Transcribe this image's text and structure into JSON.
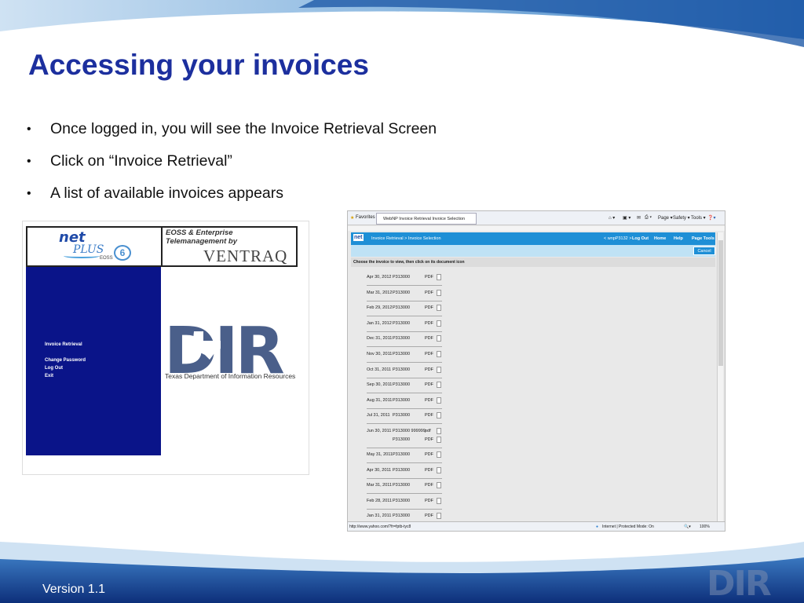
{
  "slide": {
    "title": "Accessing your invoices",
    "bullets": [
      "Once logged in, you will see the Invoice Retrieval Screen",
      "Click on “Invoice Retrieval”",
      "A list of available invoices appears"
    ],
    "bullet_glyph": "•",
    "footer": "Version 1.1",
    "footer_logo": "DIR"
  },
  "screenshot1": {
    "logo_net": "net",
    "logo_plus": "PLUS",
    "logo_eoss": "EOSS",
    "logo_6": "6",
    "header_line1": "EOSS & Enterprise",
    "header_line2": "Telemanagement by",
    "vendor": "VENTRAQ",
    "nav": [
      "Invoice Retrieval",
      "Change Password",
      "Log Out",
      "Exit"
    ],
    "dir_letters": "DIR",
    "dir_caption": "Texas Department of Information Resources"
  },
  "screenshot2": {
    "favorites": "Favorites",
    "tab_title": "WebNP Invoice Retrieval Invoice Selection",
    "toolbar": [
      "Page ▾",
      "Safety ▾",
      "Tools ▾"
    ],
    "breadcrumb": "Invoice Retrieval > Invoice Selection",
    "user": "< wnpP3132 >",
    "nav": [
      "Log Out",
      "Home",
      "Help",
      "Page Tools"
    ],
    "cancel": "Cancel",
    "instruction": "Choose the invoice to view, then click on its document icon",
    "invoices": [
      {
        "date": "Apr 30, 2012",
        "account": "P313000",
        "type": "PDF"
      },
      {
        "date": "Mar 31, 2012",
        "account": "P313000",
        "type": "PDF"
      },
      {
        "date": "Feb 29, 2012",
        "account": "P313000",
        "type": "PDF"
      },
      {
        "date": "Jan 31, 2012",
        "account": "P313000",
        "type": "PDF"
      },
      {
        "date": "Dec 31, 2011",
        "account": "P313000",
        "type": "PDF"
      },
      {
        "date": "Nov 30, 2011",
        "account": "P313000",
        "type": "PDF"
      },
      {
        "date": "Oct 31, 2011",
        "account": "P313000",
        "type": "PDF"
      },
      {
        "date": "Sep 30, 2011",
        "account": "P313000",
        "type": "PDF"
      },
      {
        "date": "Aug 31, 2011",
        "account": "P313000",
        "type": "PDF"
      },
      {
        "date": "Jul 31, 2011",
        "account": "P313000",
        "type": "PDF"
      },
      {
        "date": "Jun 30, 2011",
        "account": "P313000 999999",
        "type": "pdf",
        "account2": "P313000",
        "type2": "PDF"
      },
      {
        "date": "May 31, 2011",
        "account": "P313000",
        "type": "PDF"
      },
      {
        "date": "Apr 30, 2011",
        "account": "P313000",
        "type": "PDF"
      },
      {
        "date": "Mar 31, 2011",
        "account": "P313000",
        "type": "PDF"
      },
      {
        "date": "Feb 28, 2011",
        "account": "P313000",
        "type": "PDF"
      },
      {
        "date": "Jan 31, 2011",
        "account": "P313000",
        "type": "PDF"
      }
    ],
    "status_url": "http://www.yahoo.com/?fr=fptb-tyc8",
    "status_zone": "Internet | Protected Mode: On",
    "zoom": "100%"
  }
}
